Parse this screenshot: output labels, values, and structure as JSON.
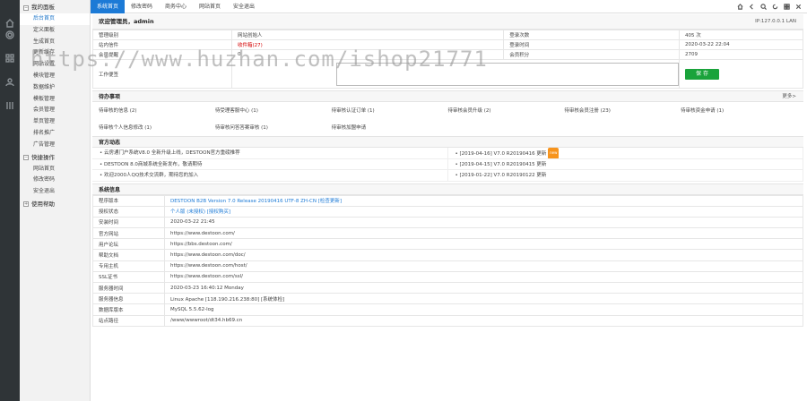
{
  "sidebar": {
    "group1": "我的面板",
    "items1": [
      "后台首页",
      "定义面板",
      "生成首页",
      "更新缓存",
      "网站设置",
      "模块管理",
      "数据维护",
      "模板管理",
      "会员管理",
      "单页管理",
      "排名推广",
      "广告管理"
    ],
    "group2": "快捷操作",
    "items2": [
      "网站首页",
      "修改密码",
      "安全退出"
    ],
    "group3": "使用帮助"
  },
  "top": {
    "tabs": [
      "系统首页",
      "修改密码",
      "商务中心",
      "网站首页",
      "安全退出"
    ]
  },
  "welcome": {
    "text": "欢迎管理员，admin",
    "ip": "IP:127.0.0.1 LAN"
  },
  "info": {
    "rows": [
      {
        "k1": "管理级别",
        "v1": "网站创始人",
        "k2": "登录次数",
        "v2": "405 次"
      },
      {
        "k1": "站内信件",
        "v1": "收件箱(27)",
        "k2": "登录时间",
        "v2": "2020-03-22 22:04"
      },
      {
        "k1": "会员提醒",
        "v1": "0",
        "k2": "会员积分",
        "v2": "2709"
      }
    ],
    "notes_label": "工作便签",
    "save": "保 存"
  },
  "todo": {
    "title": "待办事项",
    "more": "更多>",
    "items": [
      "待审核的信息 (2)",
      "待受理客服中心 (1)",
      "待审核认证订单 (1)",
      "待审核会员升级 (2)",
      "待审核会员注册 (23)",
      "待审核资金申请 (1)",
      "待审核个人信息修改 (1)",
      "待审核问答答案审核 (1)",
      "待审核加盟申请"
    ]
  },
  "news": {
    "title": "官方动态",
    "left": [
      "• 云房通门户系统V8.0 全新升级上线，DESTOON官方重磅推荐",
      "• DESTOON 8.0商城系统全新发布，敬请期待",
      "• 欢迎2000人QQ技术交流群，期待您的加入"
    ],
    "right": [
      "• [2019-04-16]  V7.0 R20190416 更新",
      "• [2019-04-15]  V7.0 R20190415 更新",
      "• [2019-01-22]  V7.0 R20190122 更新"
    ],
    "hot": "new"
  },
  "sys": {
    "title": "系统信息",
    "rows": [
      {
        "k": "程序版本",
        "v": "DESTOON B2B Version 7.0 Release 20190416 UTF-8 ZH-CN [检查更新]"
      },
      {
        "k": "授权状态",
        "v": "个人版 (未授权) [授权购买]"
      },
      {
        "k": "安装时间",
        "v": "2020-03-22 21:45"
      },
      {
        "k": "官方网站",
        "v": "https://www.destoon.com/"
      },
      {
        "k": "用户论坛",
        "v": "https://bbs.destoon.com/"
      },
      {
        "k": "帮助文档",
        "v": "https://www.destoon.com/doc/"
      },
      {
        "k": "专用主机",
        "v": "https://www.destoon.com/host/"
      },
      {
        "k": "SSL证书",
        "v": "https://www.destoon.com/ssl/"
      },
      {
        "k": "服务器时间",
        "v": "2020-03-23 16:40:12 Monday"
      },
      {
        "k": "服务器信息",
        "v": "Linux Apache [118.190.216.238:80] [系统体检]"
      },
      {
        "k": "数据库版本",
        "v": "MySQL 5.5.62-log"
      },
      {
        "k": "站点路径",
        "v": "/www/wwwroot/dt34.hb69.cn"
      }
    ]
  },
  "watermark": "https://www.huzhan.com/ishop21771",
  "colors": {
    "accent": "#1c7ad6",
    "sidebar": "#2f3437",
    "save": "#1aa33b"
  }
}
